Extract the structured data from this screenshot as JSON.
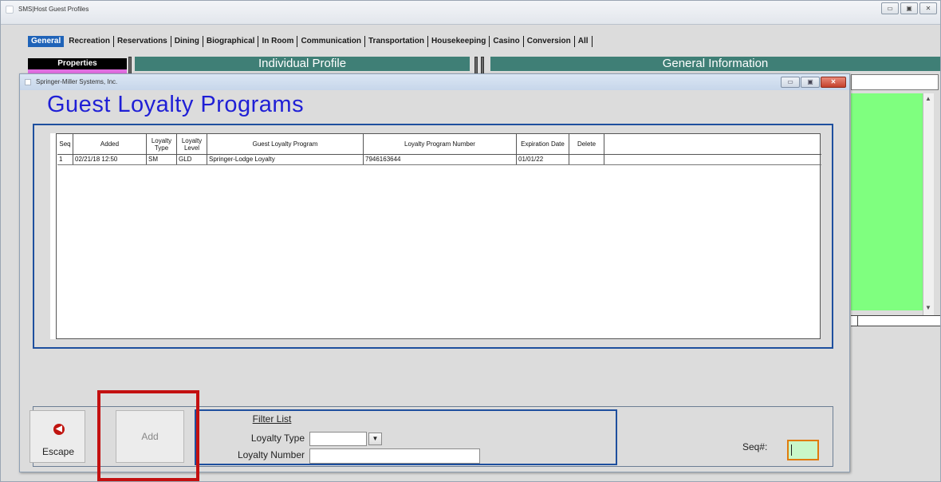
{
  "outer_window": {
    "title": "SMS|Host Guest Profiles",
    "controls": [
      "▭",
      "▣",
      "✕"
    ]
  },
  "tabs": [
    "General",
    "Recreation",
    "Reservations",
    "Dining",
    "Biographical",
    "In Room",
    "Communication",
    "Transportation",
    "Housekeeping",
    "Casino",
    "Conversion",
    "All"
  ],
  "background": {
    "properties_label": "Properties",
    "individual_profile": "Individual Profile",
    "general_information": "General Information"
  },
  "dialog": {
    "title": "Springer-Miller Systems, Inc.",
    "controls": [
      "▭",
      "▣",
      "✕"
    ],
    "heading": "Guest Loyalty Programs",
    "grid": {
      "columns": [
        "Seq",
        "Added",
        "Loyalty Type",
        "Loyalty Level",
        "Guest Loyalty Program",
        "Loyalty Program Number",
        "Expiration Date",
        "Delete"
      ],
      "rows": [
        [
          "1",
          "02/21/18 12:50",
          "SM",
          "GLD",
          "Springer-Lodge Loyalty",
          "7946163644",
          "01/01/22",
          ""
        ]
      ]
    },
    "escape_label": "Escape",
    "add_label": "Add",
    "filter": {
      "title": "Filter List",
      "loyalty_type_label": "Loyalty Type",
      "loyalty_type_value": "",
      "loyalty_number_label": "Loyalty Number",
      "loyalty_number_value": ""
    },
    "seq_label": "Seq#:",
    "seq_value": ""
  },
  "colors": {
    "heading": "#1f1fd6",
    "banner": "#3f7f76",
    "active_tab": "#1f63b8",
    "highlight": "#c31010",
    "green_panel": "#7fff7f"
  }
}
